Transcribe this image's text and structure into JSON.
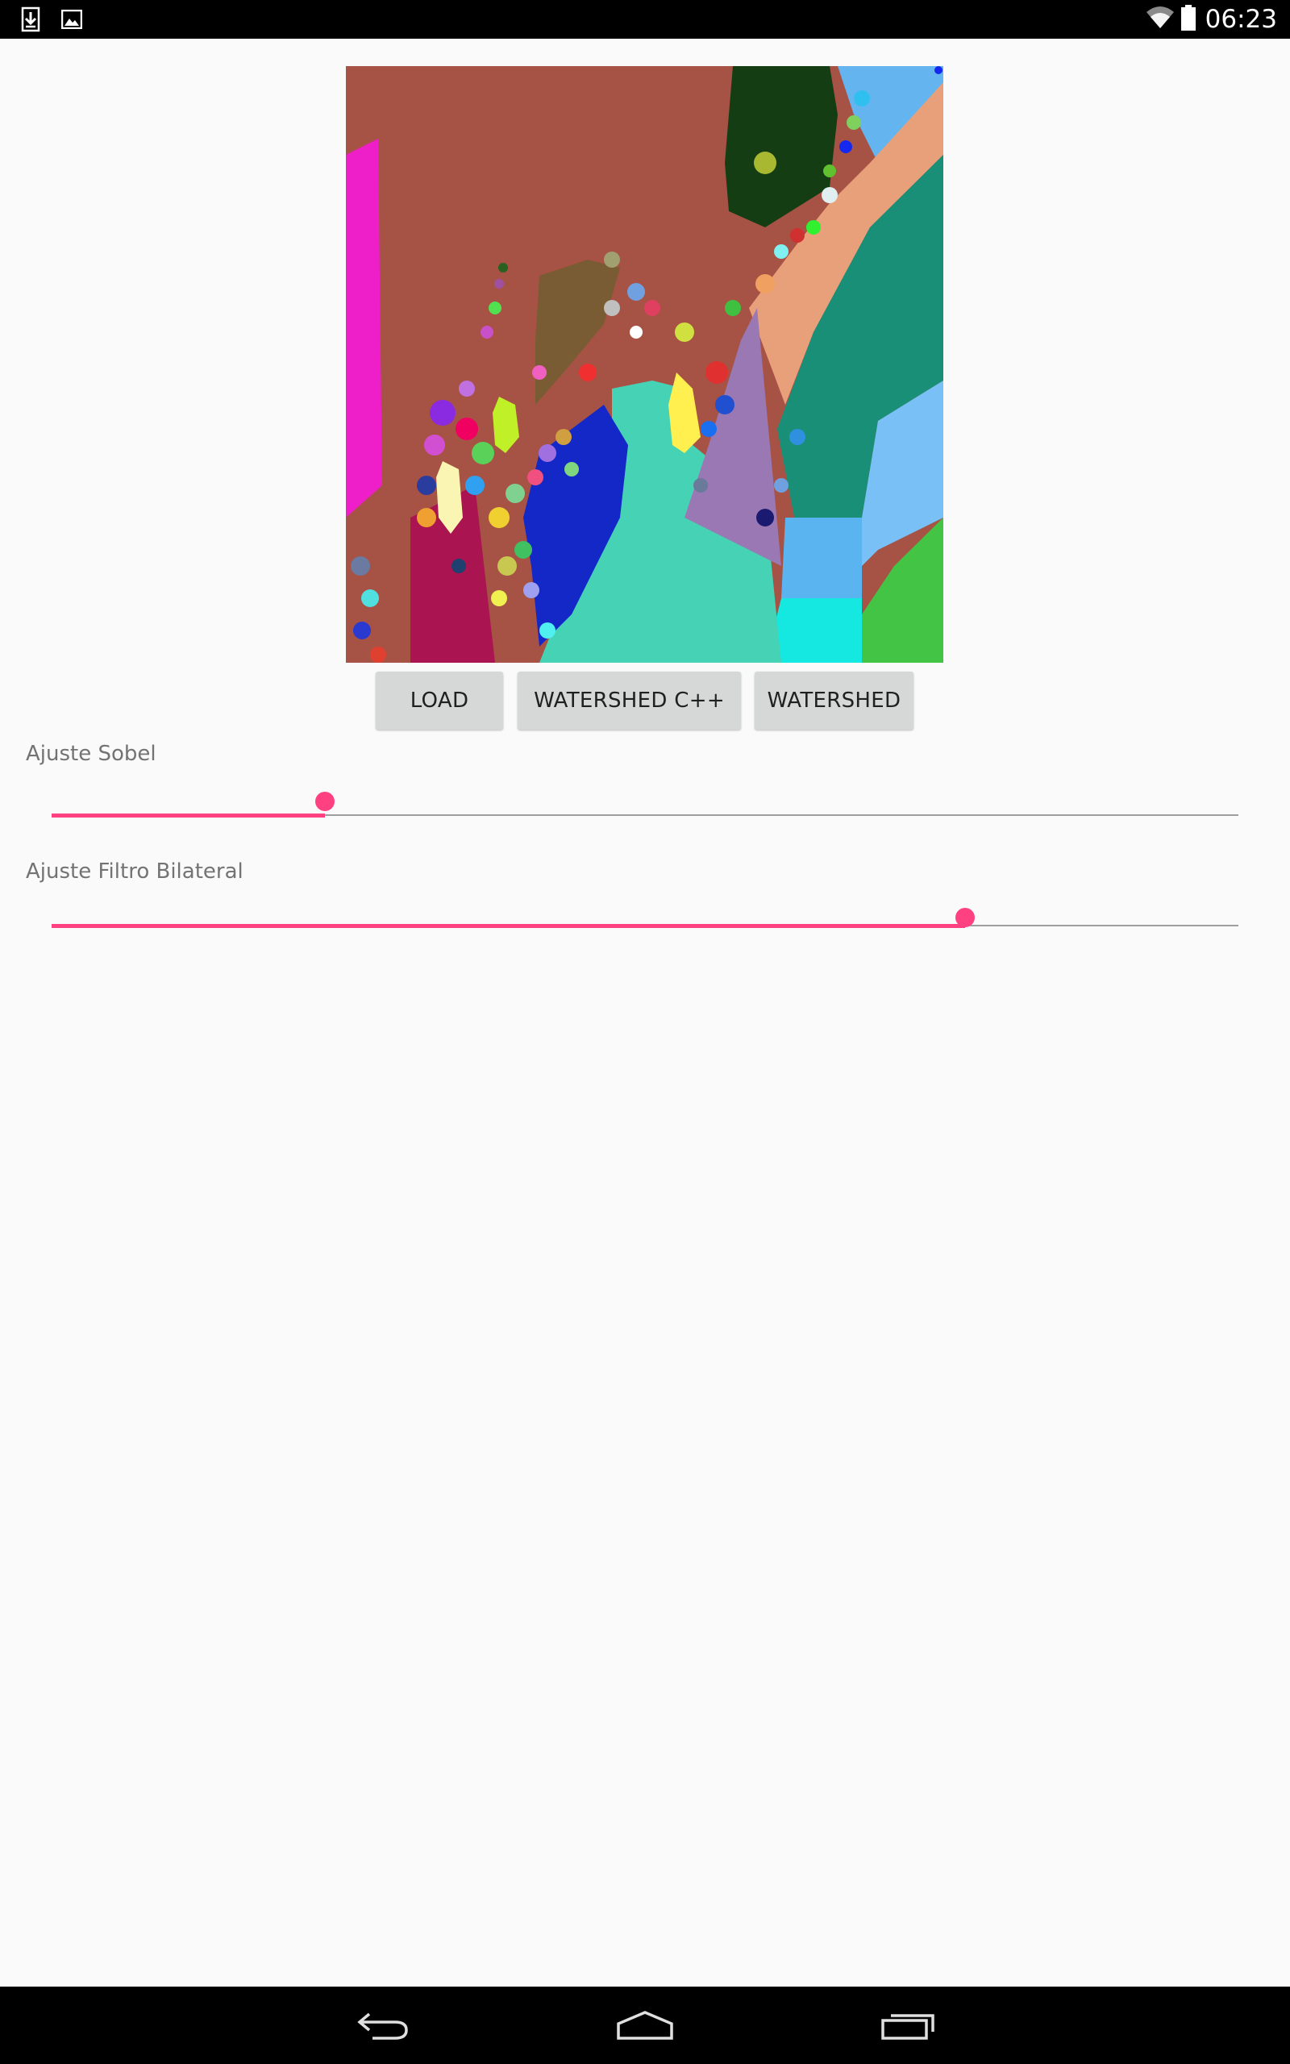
{
  "status_bar": {
    "time": "06:23",
    "left_icons": [
      "download-icon",
      "image-icon"
    ],
    "right_icons": [
      "wifi-icon",
      "battery-icon"
    ]
  },
  "image": {
    "description_icon": "segmentation-result-image"
  },
  "buttons": {
    "load": "LOAD",
    "watershed_cpp": "WATERSHED C++",
    "watershed": "WATERSHED"
  },
  "sliders": [
    {
      "label": "Ajuste Sobel",
      "value": 0.23
    },
    {
      "label": "Ajuste Filtro Bilateral",
      "value": 0.77
    }
  ],
  "nav_bar": {
    "icons": [
      "back-icon",
      "home-icon",
      "recents-icon"
    ]
  },
  "colors": {
    "accent": "#ff4081",
    "background": "#fafafa",
    "button": "#d6d7d7"
  }
}
